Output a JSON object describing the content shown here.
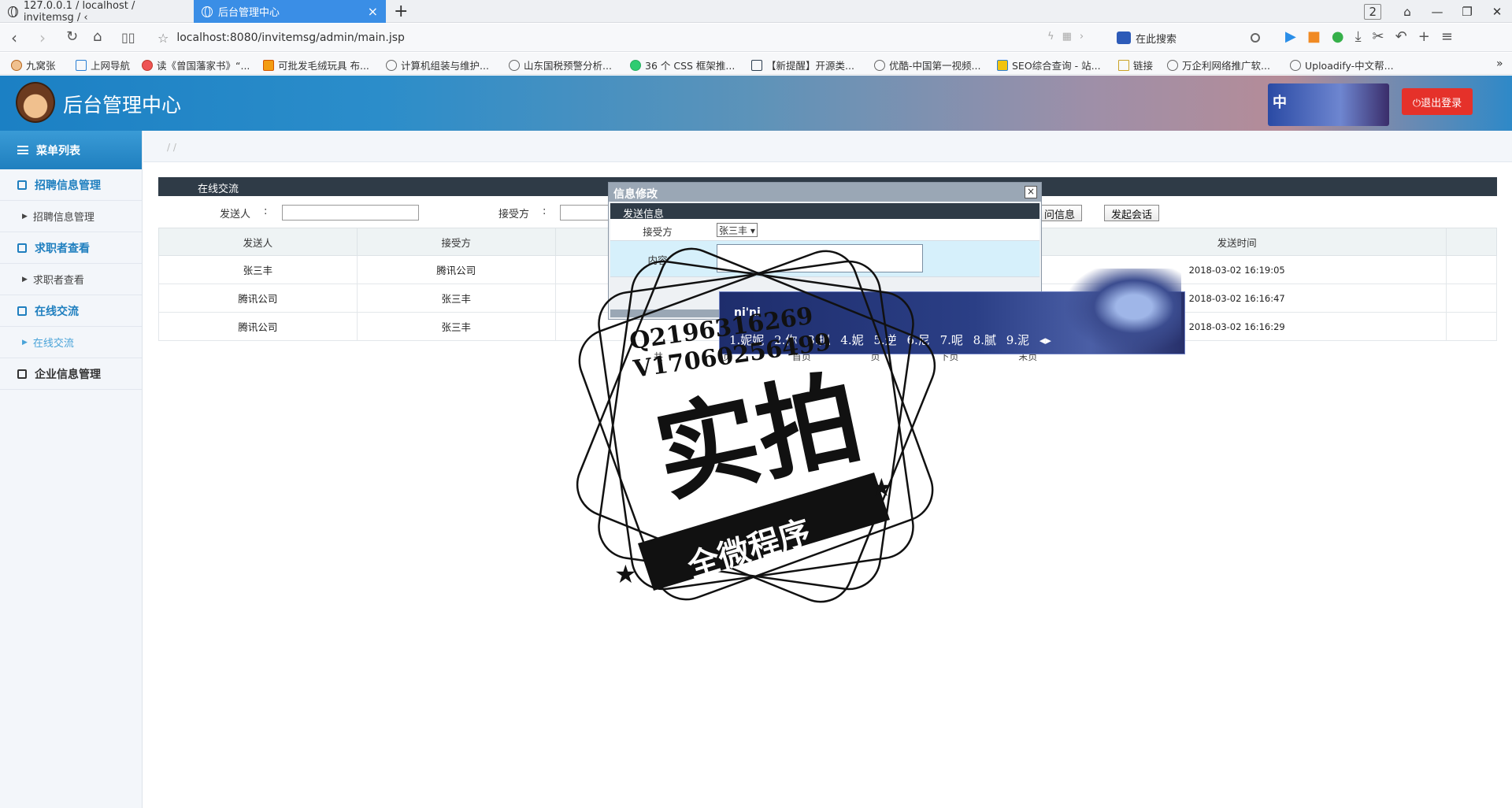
{
  "browser": {
    "tabs": [
      {
        "label": "127.0.0.1 / localhost / invitemsg / ‹"
      },
      {
        "label": "后台管理中心"
      }
    ],
    "tab_count": "2",
    "url": "localhost:8080/invitemsg/admin/main.jsp",
    "search_placeholder": "在此搜索",
    "bookmarks": [
      "九窝张",
      "上网导航",
      "读《曾国藩家书》“...",
      "可批发毛绒玩具 布...",
      "计算机组装与维护...",
      "山东国税预警分析...",
      "36 个 CSS 框架推...",
      "【新提醒】开源类...",
      "优酷-中国第一视频...",
      "SEO综合查询 - 站...",
      "链接",
      "万企利网络推广软...",
      "Uploadify-中文帮..."
    ]
  },
  "header": {
    "title": "后台管理中心",
    "ime_label": "中",
    "logout_label": "⏻退出登录"
  },
  "sidebar": {
    "heading": "菜单列表",
    "groups": [
      {
        "label": "招聘信息管理",
        "sub": "招聘信息管理"
      },
      {
        "label": "求职者查看",
        "sub": "求职者查看"
      },
      {
        "label": "在线交流",
        "sub": "在线交流"
      },
      {
        "label": "企业信息管理"
      }
    ]
  },
  "main": {
    "breadcrumb": "/   /",
    "panel_title": "在线交流",
    "filter": {
      "sender_label": "发送人",
      "receiver_label": "接受方",
      "colon": ":",
      "query_button": "问信息",
      "start_chat_button": "发起会话"
    },
    "table": {
      "columns": [
        "发送人",
        "接受方",
        "",
        "发送时间",
        ""
      ],
      "rows": [
        [
          "张三丰",
          "腾讯公司",
          "",
          "2018-03-02 16:19:05",
          ""
        ],
        [
          "腾讯公司",
          "张三丰",
          "",
          "2018-03-02 16:16:47",
          ""
        ],
        [
          "腾讯公司",
          "张三丰",
          "",
          "2018-03-02 16:16:29",
          ""
        ]
      ]
    },
    "pager": [
      "共",
      "页",
      "首页",
      "页",
      "下页",
      "末页"
    ]
  },
  "modal": {
    "title": "信息修改",
    "close": "×",
    "section": "发送信息",
    "receiver_label": "接受方",
    "receiver_value": "张三丰 ▾",
    "content_label": "内容"
  },
  "ime": {
    "pinyin": "ni'ni",
    "candidates": [
      "1.妮妮",
      "2.你",
      "3.拟",
      "4.妮",
      "5.逆",
      "6.尼",
      "7.呢",
      "8.腻",
      "9.泥"
    ],
    "arrows": "◂▸"
  },
  "watermark": {
    "line1": "Q2196316269",
    "line2": "V17060256499",
    "main": "实拍",
    "ribbon": "全微程序"
  },
  "colors": {
    "accent": "#1f7fbf",
    "logout": "#e5312a",
    "panel_header": "#2f3b47"
  }
}
